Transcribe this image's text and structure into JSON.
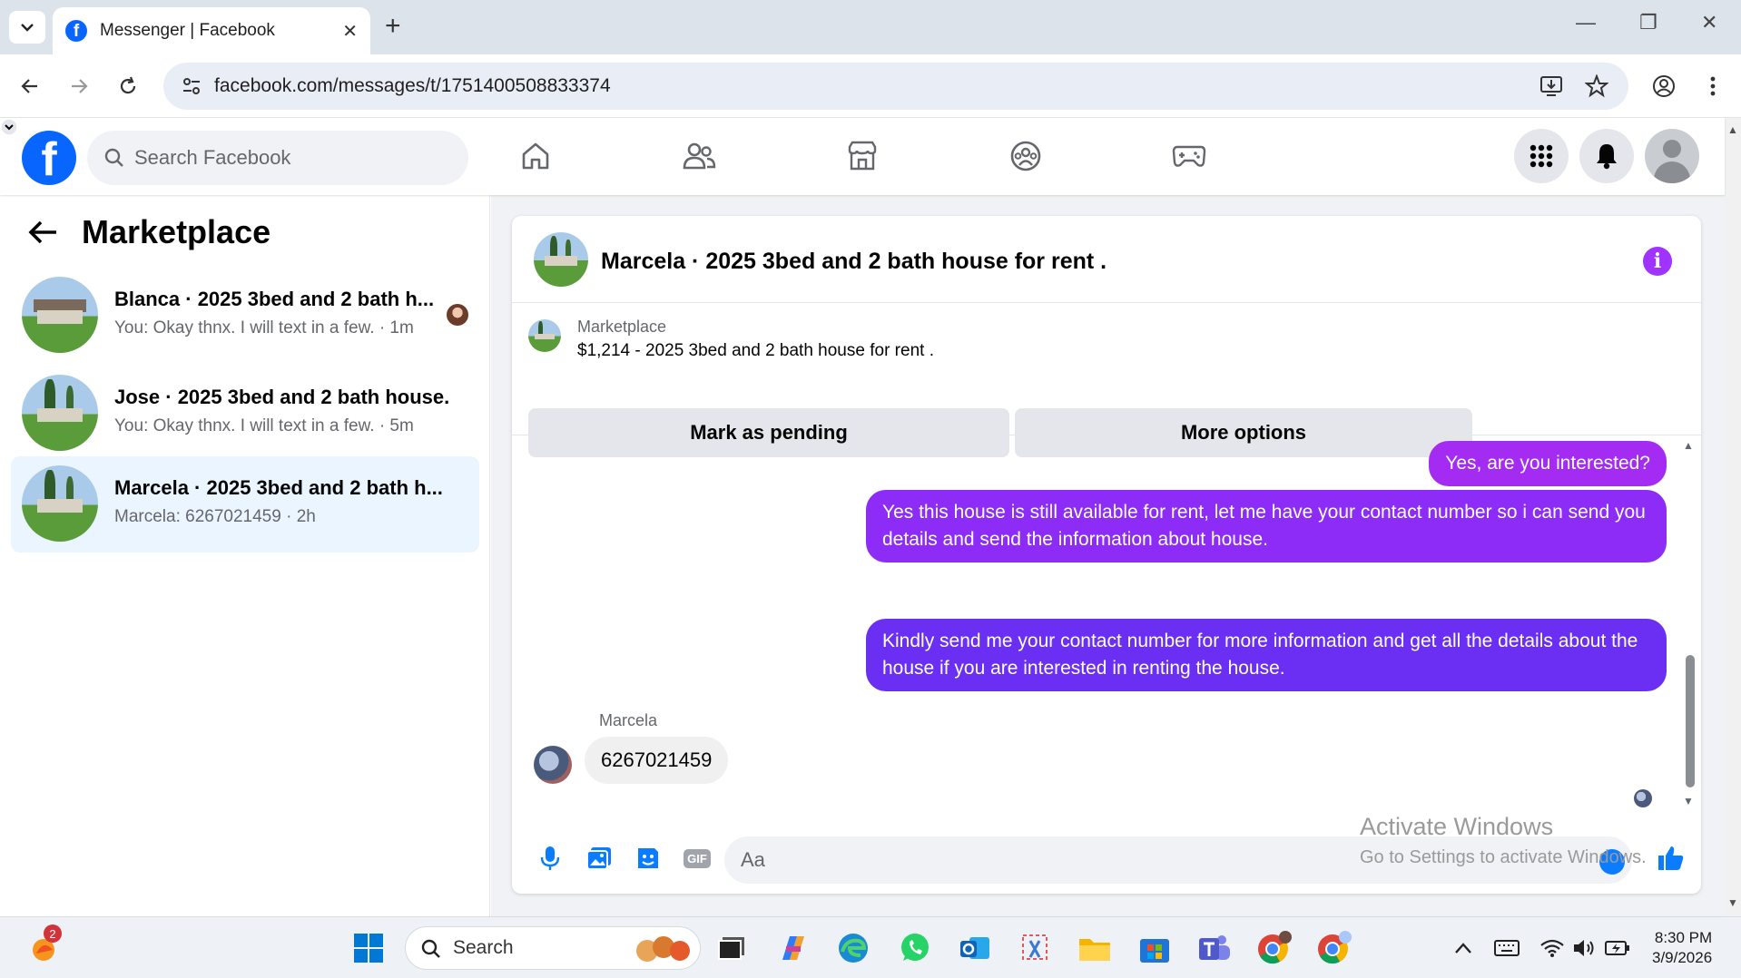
{
  "browser": {
    "tab_title": "Messenger | Facebook",
    "url": "facebook.com/messages/t/1751400508833374"
  },
  "header": {
    "search_placeholder": "Search Facebook"
  },
  "sidebar": {
    "title": "Marketplace",
    "conversations": [
      {
        "name": "Blanca · 2025 3bed and 2 bath h...",
        "preview": "You: Okay thnx. I will text in a few. · 1m",
        "active": false
      },
      {
        "name": "Jose · 2025 3bed and 2 bath house...",
        "preview": "You: Okay thnx. I will text in a few. · 5m",
        "active": false
      },
      {
        "name": "Marcela · 2025 3bed and 2 bath h...",
        "preview": "Marcela: 6267021459 · 2h",
        "active": true
      }
    ]
  },
  "chat": {
    "title": "Marcela · 2025 3bed and 2 bath house for rent .",
    "listing_category": "Marketplace",
    "listing_title": "$1,214 - 2025 3bed and 2 bath house for rent .",
    "mark_pending_label": "Mark as pending",
    "more_options_label": "More options",
    "messages_out": [
      "Yes, are you interested?",
      "Yes this house is still available for rent, let me have your contact number so i can send you details and send the information about house.",
      "Kindly send me your contact number for more information and get all the details about the house if you are interested in renting the house."
    ],
    "incoming_sender": "Marcela",
    "incoming_message": "6267021459",
    "input_placeholder": "Aa",
    "gif_label": "GIF"
  },
  "watermark": {
    "line1": "Activate Windows",
    "line2": "Go to Settings to activate Windows."
  },
  "taskbar": {
    "search_label": "Search",
    "notification_count": "2",
    "time": "8:30 PM",
    "date": "3/9/2026"
  },
  "colors": {
    "fb_blue": "#0866ff",
    "bubble_top": "#a32bf2",
    "bubble_mid": "#8c2cf6",
    "bubble_bottom": "#6b2ff3",
    "active_row": "#ebf5ff"
  }
}
